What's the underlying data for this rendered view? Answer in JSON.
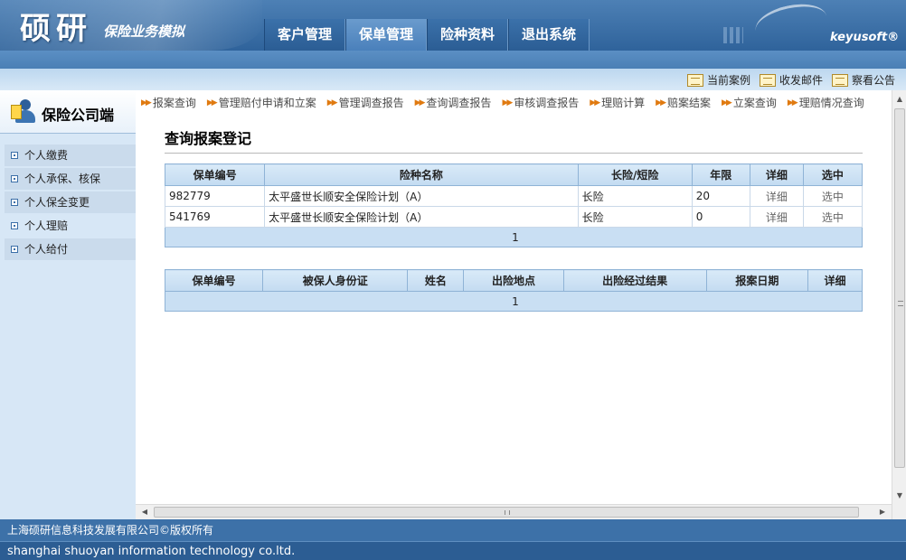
{
  "header": {
    "logo_main": "硕研",
    "logo_sub": "保险业务模拟",
    "brand": "keyusoft®",
    "nav": [
      "客户管理",
      "保单管理",
      "险种资料",
      "退出系统"
    ],
    "nav_active": "保单管理"
  },
  "quicklinks": [
    "当前案例",
    "收发邮件",
    "察看公告"
  ],
  "sidebar": {
    "title": "保险公司端",
    "items": [
      "个人缴费",
      "个人承保、核保",
      "个人保全变更",
      "个人理赔",
      "个人给付"
    ],
    "active": "个人理赔"
  },
  "breadcrumbs": [
    "报案查询",
    "管理赔付申请和立案",
    "管理调查报告",
    "查询调查报告",
    "审核调查报告",
    "理赔计算",
    "赔案结案",
    "立案查询",
    "理赔情况查询"
  ],
  "page_title": "查询报案登记",
  "policy_table": {
    "headers": [
      "保单编号",
      "险种名称",
      "长险/短险",
      "年限",
      "详细",
      "选中"
    ],
    "rows": [
      [
        "982779",
        "太平盛世长顺安全保险计划（A）",
        "长险",
        "20",
        "详细",
        "选中"
      ],
      [
        "541769",
        "太平盛世长顺安全保险计划（A）",
        "长险",
        "0",
        "详细",
        "选中"
      ]
    ],
    "pager": "1"
  },
  "report_table": {
    "headers": [
      "保单编号",
      "被保人身份证",
      "姓名",
      "出险地点",
      "出险经过结果",
      "报案日期",
      "详细"
    ],
    "pager": "1"
  },
  "footer": {
    "line1": "上海硕研信息科技发展有限公司©版权所有",
    "line2": "shanghai shuoyan information technology co.ltd."
  }
}
